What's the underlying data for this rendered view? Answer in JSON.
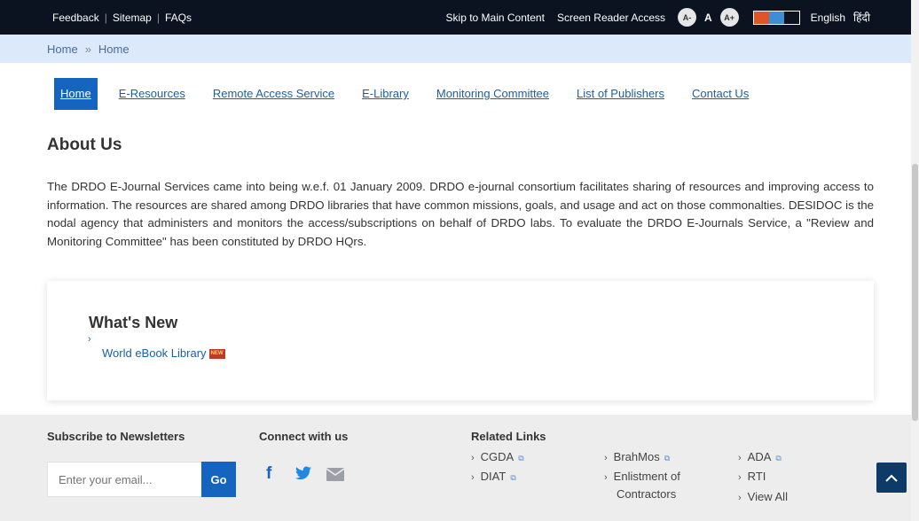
{
  "topbar": {
    "feedback": "Feedback",
    "sitemap": "Sitemap",
    "faqs": "FAQs",
    "separator": "|",
    "skip": "Skip to Main Content",
    "screen_reader": "Screen Reader Access",
    "font_decrease": "A-",
    "font_normal": "A",
    "font_increase": "A+",
    "contrast_colors": [
      "#e0542a",
      "#3e8ed6",
      "#0b1220"
    ],
    "lang_english": "English",
    "lang_hindi": "हिंदी"
  },
  "breadcrumb": {
    "home": "Home",
    "separator": "»",
    "current": "Home"
  },
  "nav": {
    "items": [
      "Home",
      "E-Resources",
      "Remote Access Service",
      "E-Library",
      "Monitoring Committee",
      "List of Publishers",
      "Contact Us"
    ]
  },
  "about": {
    "title": "About Us",
    "text": "The DRDO E-Journal Services came into being w.e.f. 01 January 2009. DRDO e-journal consortium facilitates sharing of resources and improving access to information. The resources are shared among DRDO libraries that have common missions, goals, and usage and act on those commonalties. DESIDOC is the nodal agency that administers and monitors the access/subscriptions on behalf of DRDO labs. To evaluate the DRDO E-Journals Service, a \"Review and Monitoring Committee\" has been constituted by DRDO HQrs."
  },
  "whats_new": {
    "title": "What's New",
    "chevron": "›",
    "item": "World eBook Library",
    "badge": "NEW"
  },
  "footer": {
    "subscribe_title": "Subscribe to Newsletters",
    "email_placeholder": "Enter your email...",
    "go": "Go",
    "connect_title": "Connect with us",
    "related_title": "Related Links",
    "links": {
      "cgda": "CGDA",
      "diat": "DIAT",
      "brahmos": "BrahMos",
      "enlistment_1": "Enlistment of",
      "enlistment_2": "Contractors",
      "ada": "ADA",
      "rti": "RTI",
      "view_all": "View All"
    },
    "chevron": "›"
  },
  "icons": {
    "facebook": "f",
    "twitter": "🐦",
    "mail": "✉",
    "external": "⧉",
    "up": "⌃"
  },
  "colors": {
    "primary": "#1565c0",
    "topbar_bg": "#0b1220",
    "breadcrumb_bg": "#dbe9fb",
    "to_top_bg": "#0d3a66"
  }
}
